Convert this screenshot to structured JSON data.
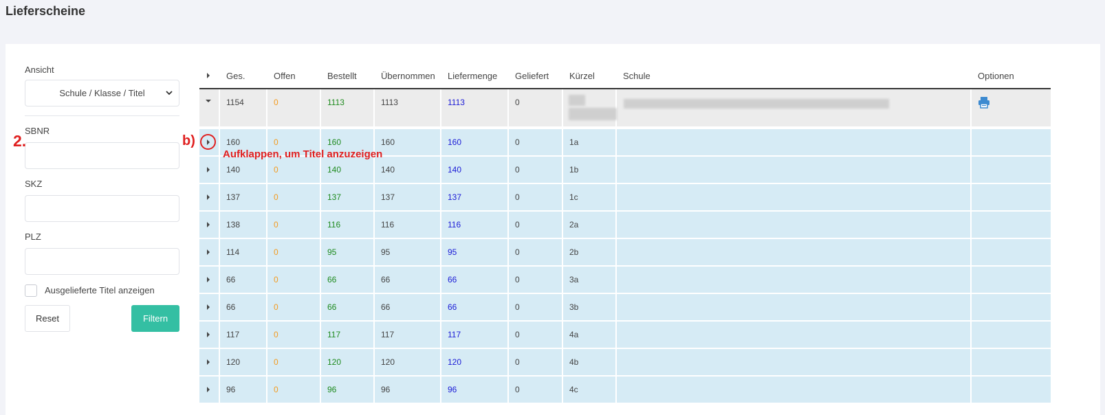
{
  "page": {
    "title": "Lieferscheine"
  },
  "filters": {
    "ansicht_label": "Ansicht",
    "ansicht_value": "Schule / Klasse / Titel",
    "sbnr_label": "SBNR",
    "sbnr_value": "",
    "skz_label": "SKZ",
    "skz_value": "",
    "plz_label": "PLZ",
    "plz_value": "",
    "checkbox_label": "Ausgelieferte Titel anzeigen",
    "reset_label": "Reset",
    "filter_label": "Filtern"
  },
  "annotations": {
    "step_number": "2.",
    "marker_b": "b)",
    "hint_text": "Aufklappen, um Titel anzuzeigen",
    "color": "#e02020"
  },
  "table": {
    "columns": [
      "Ges.",
      "Offen",
      "Bestellt",
      "Übernommen",
      "Liefermenge",
      "Geliefert",
      "Kürzel",
      "Schule",
      "Optionen"
    ],
    "parent": {
      "ges": "1154",
      "offen": "0",
      "bestellt": "1113",
      "uebernommen": "1113",
      "liefermenge": "1113",
      "geliefert": "0",
      "kuerzel": "",
      "schule": ""
    },
    "rows": [
      {
        "ges": "160",
        "offen": "0",
        "bestellt": "160",
        "uebernommen": "160",
        "liefermenge": "160",
        "geliefert": "0",
        "kuerzel": "1a"
      },
      {
        "ges": "140",
        "offen": "0",
        "bestellt": "140",
        "uebernommen": "140",
        "liefermenge": "140",
        "geliefert": "0",
        "kuerzel": "1b"
      },
      {
        "ges": "137",
        "offen": "0",
        "bestellt": "137",
        "uebernommen": "137",
        "liefermenge": "137",
        "geliefert": "0",
        "kuerzel": "1c"
      },
      {
        "ges": "138",
        "offen": "0",
        "bestellt": "116",
        "uebernommen": "116",
        "liefermenge": "116",
        "geliefert": "0",
        "kuerzel": "2a"
      },
      {
        "ges": "114",
        "offen": "0",
        "bestellt": "95",
        "uebernommen": "95",
        "liefermenge": "95",
        "geliefert": "0",
        "kuerzel": "2b"
      },
      {
        "ges": "66",
        "offen": "0",
        "bestellt": "66",
        "uebernommen": "66",
        "liefermenge": "66",
        "geliefert": "0",
        "kuerzel": "3a"
      },
      {
        "ges": "66",
        "offen": "0",
        "bestellt": "66",
        "uebernommen": "66",
        "liefermenge": "66",
        "geliefert": "0",
        "kuerzel": "3b"
      },
      {
        "ges": "117",
        "offen": "0",
        "bestellt": "117",
        "uebernommen": "117",
        "liefermenge": "117",
        "geliefert": "0",
        "kuerzel": "4a"
      },
      {
        "ges": "120",
        "offen": "0",
        "bestellt": "120",
        "uebernommen": "120",
        "liefermenge": "120",
        "geliefert": "0",
        "kuerzel": "4b"
      },
      {
        "ges": "96",
        "offen": "0",
        "bestellt": "96",
        "uebernommen": "96",
        "liefermenge": "96",
        "geliefert": "0",
        "kuerzel": "4c"
      }
    ],
    "colors": {
      "offen": "#f39a1e",
      "bestellt": "#1e8a1e",
      "liefermenge": "#1a1ad6",
      "row_bg": "#d6ebf5",
      "parent_bg": "#ececec",
      "print_icon": "#3d8ad0"
    },
    "icons": {
      "expand": "caret-right-icon",
      "collapse": "caret-down-icon",
      "print": "print-icon"
    }
  }
}
